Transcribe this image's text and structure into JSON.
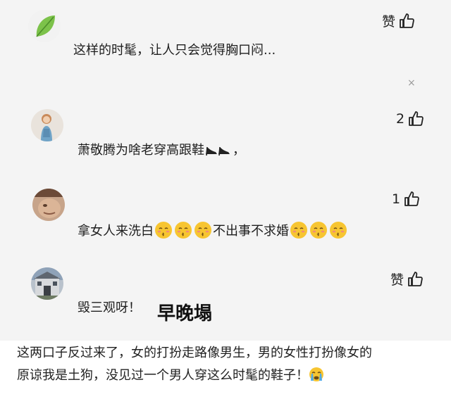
{
  "comments": [
    {
      "avatar": "leaf-avatar",
      "text": "这样的时髦，让人只会觉得胸口闷...",
      "like_label": "赞",
      "like_icon": "thumbs-up-icon"
    },
    {
      "avatar": "girl-avatar",
      "text": "萧敬腾为啥老穿高跟鞋",
      "text_suffix": "，",
      "inline_icon": "high-heels-icon",
      "like_count": "2",
      "like_icon": "thumbs-up-icon"
    },
    {
      "avatar": "face-avatar",
      "text_before": "拿女人来洗白",
      "text_middle": "不出事不求婚",
      "inline_icon": "kissing-face-emoji",
      "like_count": "1",
      "like_icon": "thumbs-up-icon"
    },
    {
      "avatar": "building-avatar",
      "text": "毁三观呀！",
      "sticker_text": "早晚塌",
      "like_label": "赞",
      "like_icon": "thumbs-up-icon"
    }
  ],
  "close_glyph": "×",
  "bottom_paragraph": {
    "line1": "这两口子反过来了，女的打扮走路像男生，男的女性打扮像女的",
    "line2": "原谅我是土狗，没见过一个男人穿这么时髦的鞋子！",
    "emoji": "crying-face-emoji"
  },
  "colors": {
    "panel_bg": "#f4f4f4",
    "page_bg": "#ffffff",
    "emoji_yellow": "#f7c531"
  }
}
